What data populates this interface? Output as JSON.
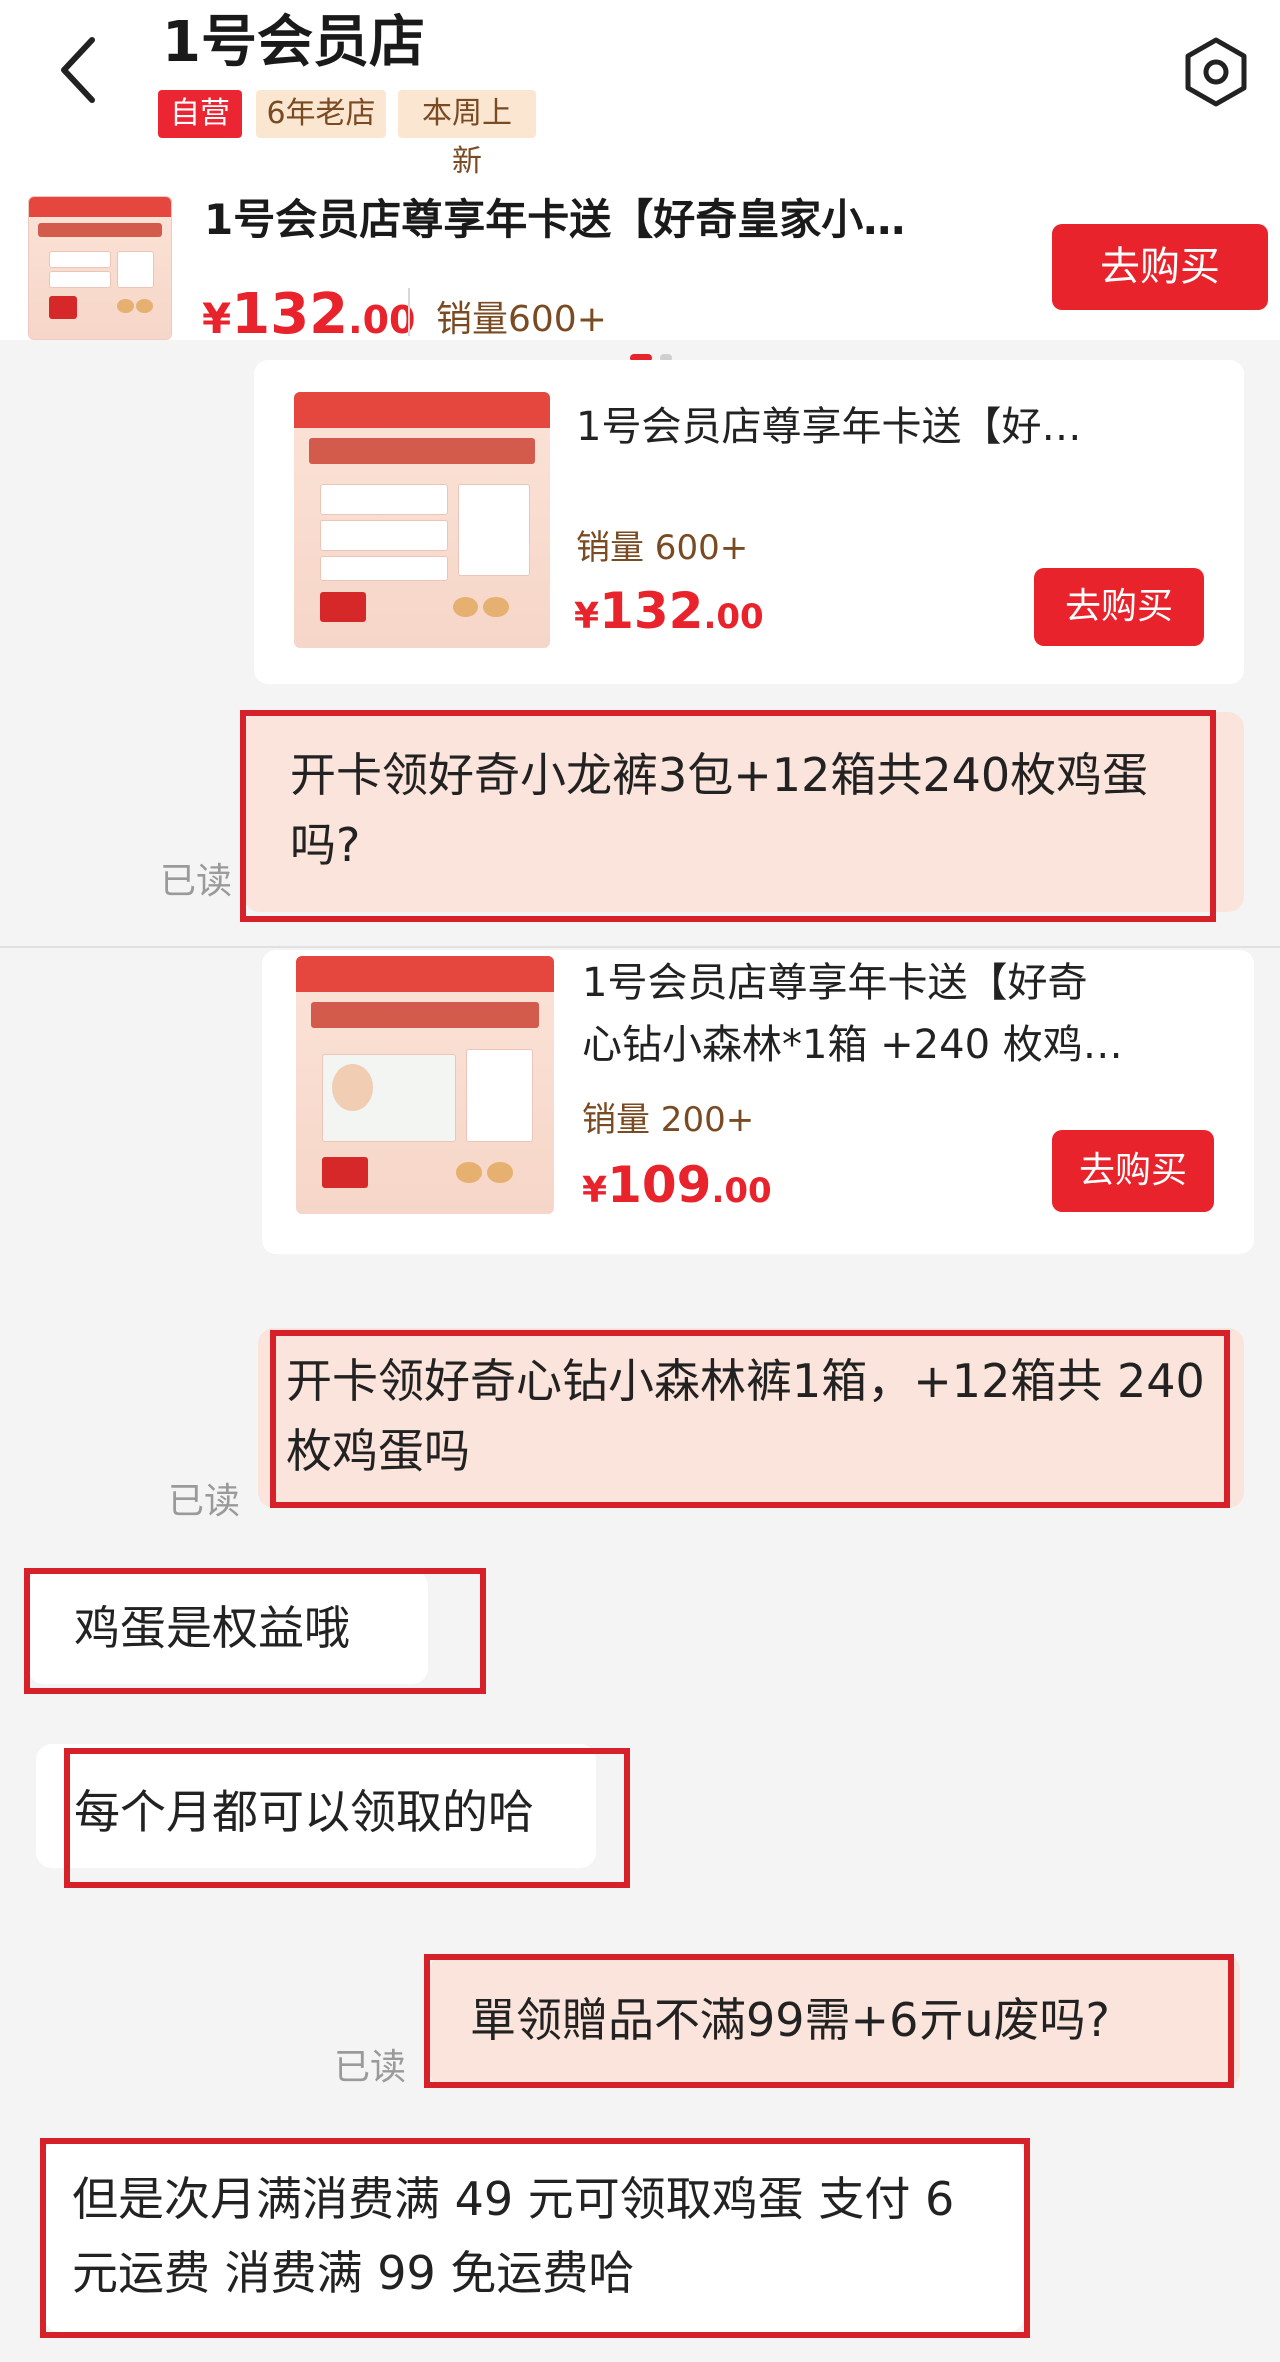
{
  "header": {
    "shop_name": "1号会员店",
    "tags": [
      "自营",
      "6年老店",
      "本周上新"
    ]
  },
  "top_product": {
    "title": "1号会员店尊享年卡送【好奇皇家小…",
    "price_currency": "¥",
    "price_int": "132",
    "price_dec": ".00",
    "sales": "销量600+",
    "buy_label": "去购买"
  },
  "cards": [
    {
      "title": "1号会员店尊享年卡送【好…",
      "sales": "销量 600+",
      "price_currency": "¥",
      "price_int": "132",
      "price_dec": ".00",
      "buy_label": "去购买"
    },
    {
      "title_line1": "1号会员店尊享年卡送【好奇",
      "title_line2": "心钻小森林*1箱 +240 枚鸡…",
      "sales": "销量 200+",
      "price_currency": "¥",
      "price_int": "109",
      "price_dec": ".00",
      "buy_label": "去购买"
    }
  ],
  "messages": {
    "m1": "开卡领好奇小龙裤3包+12箱共240枚鸡蛋吗?",
    "m2": "开卡领好奇心钻小森林裤1箱，+12箱共 240 枚鸡蛋吗",
    "m3": "鸡蛋是权益哦",
    "m4": "每个月都可以领取的哈",
    "m5": "單领贈品不滿99需+6亓u废吗?",
    "m6": "但是次月满消费满 49 元可领取鸡蛋 支付 6 元运费   消费满 99 免运费哈"
  },
  "read_label": "已读",
  "icons": {
    "back": "chevron-left-icon",
    "settings": "hexagon-settings-icon"
  },
  "colors": {
    "accent": "#e8232c",
    "frame": "#d6202a",
    "my_bubble": "#fbe4dc",
    "tag_bg": "#fbe6d2"
  }
}
